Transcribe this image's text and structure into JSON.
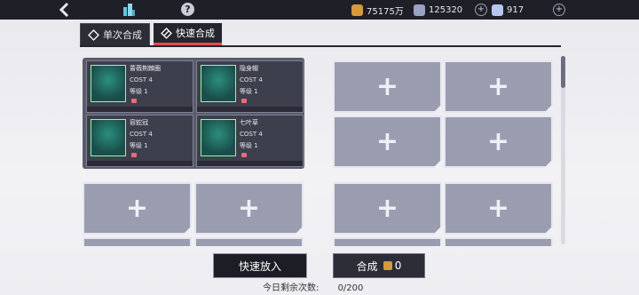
{
  "topbar": {
    "gold": "75175万",
    "crystal": "125320",
    "gem": "917"
  },
  "tabs": [
    {
      "label": "单次合成"
    },
    {
      "label": "快速合成"
    }
  ],
  "cards": [
    {
      "name": "蔷薇荆棘圈",
      "cost": "COST 4",
      "level": "等级 1"
    },
    {
      "name": "隐身帽",
      "cost": "COST 4",
      "level": "等级 1"
    },
    {
      "name": "容蛇冠",
      "cost": "COST 4",
      "level": "等级 1"
    },
    {
      "name": "七叶草",
      "cost": "COST 4",
      "level": "等级 1"
    }
  ],
  "empty_slot_symbol": "+",
  "actions": {
    "fast_put": "快速放入",
    "synth": "合成",
    "synth_cost": "0"
  },
  "remaining": {
    "label": "今日剩余次数:",
    "value": "0/200"
  },
  "help_symbol": "?"
}
